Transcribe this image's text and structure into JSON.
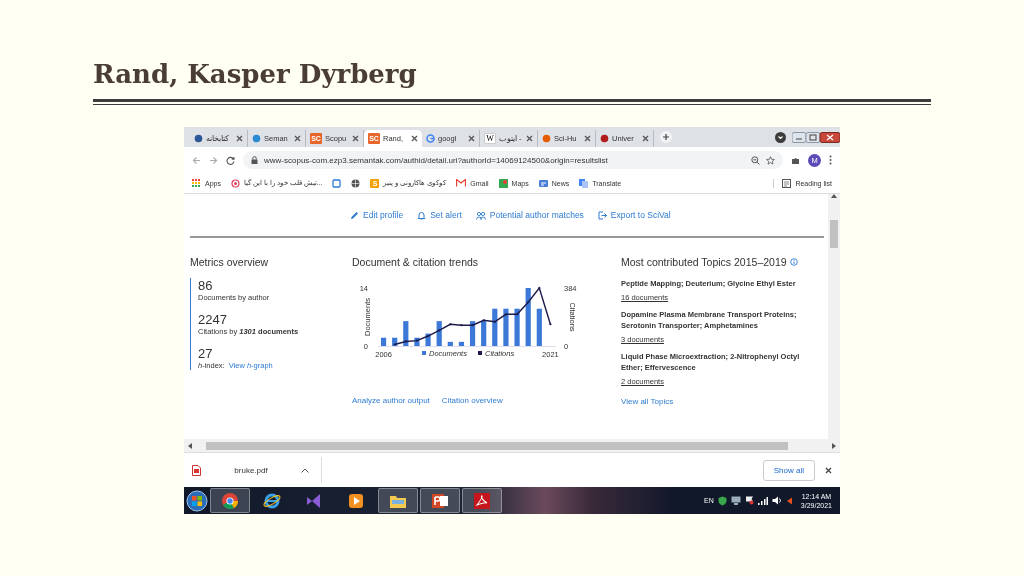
{
  "slide": {
    "title": "Rand, Kasper Dyrberg"
  },
  "browser": {
    "tabs": [
      {
        "title": "كتابخانه",
        "selected": false
      },
      {
        "title": "Seman",
        "selected": false
      },
      {
        "title": "Scopu",
        "icon_text": "SC",
        "selected": false
      },
      {
        "title": "Rand,",
        "icon_text": "SC",
        "selected": true
      },
      {
        "title": "googl",
        "selected": false
      },
      {
        "title": "ايتوب -",
        "icon_text": "W",
        "selected": false
      },
      {
        "title": "Sci-Hu",
        "selected": false
      },
      {
        "title": "Univer",
        "selected": false
      }
    ],
    "address": "www-scopus-com.ezp3.semantak.com/authid/detail.uri?authorId=14069124500&origin=resultslist",
    "profile_initial": "M",
    "bookmarks": [
      {
        "kind": "apps",
        "label": "Apps"
      },
      {
        "kind": "ring",
        "label": "تیش قلب خود را با این گیا..."
      },
      {
        "kind": "square"
      },
      {
        "kind": "globe"
      },
      {
        "kind": "letter",
        "icon_text": "S",
        "label": "کوکوی هاکارونی و پنیر"
      },
      {
        "kind": "mail",
        "label": "Gmail"
      },
      {
        "kind": "map",
        "label": "Maps"
      },
      {
        "kind": "news",
        "label": "News"
      },
      {
        "kind": "translate",
        "label": "Translate"
      }
    ],
    "reading_list": "Reading list"
  },
  "page": {
    "actions": [
      {
        "kind": "pencil",
        "label": "Edit profile"
      },
      {
        "kind": "bell",
        "label": "Set alert"
      },
      {
        "kind": "people",
        "label": "Potential author matches"
      },
      {
        "kind": "export",
        "label": "Export to SciVal"
      }
    ],
    "metrics": {
      "title": "Metrics overview",
      "items": [
        {
          "value": "86",
          "label": "Documents by author"
        },
        {
          "value": "2247",
          "label": "Citations by ***1301* documents**"
        },
        {
          "value": "27",
          "label": "*h*-index:",
          "link": "View *h*-graph"
        }
      ]
    },
    "trends": {
      "title": "Document & citation trends",
      "documents_chart": {
        "chart_data": {
          "type": "bar",
          "ylabel": "Documents",
          "x": [
            2006,
            2007,
            2008,
            2009,
            2010,
            2011,
            2012,
            2013,
            2014,
            2015,
            2016,
            2017,
            2018,
            2019,
            2020,
            2021
          ],
          "series": [
            {
              "name": "Documents",
              "color": "#3b78d8",
              "values": [
                2,
                2,
                6,
                2,
                3,
                6,
                1,
                1,
                6,
                6,
                9,
                9,
                9,
                14,
                9,
                0
              ]
            }
          ],
          "xlim": [
            2005.5,
            2021.5
          ],
          "ylim": [
            0,
            14
          ],
          "yticks": [
            0,
            14
          ],
          "xticks": [
            2006,
            2021
          ]
        }
      },
      "citations_chart": {
        "chart_data": {
          "type": "line",
          "ylabel": "Citations",
          "series": [
            {
              "name": "Citations",
              "color": "#1b1a4a",
              "values": [
                null,
                10,
                30,
                36,
                66,
                104,
                144,
                138,
                138,
                170,
                160,
                210,
                210,
                290,
                384,
                144
              ]
            }
          ],
          "ylim": [
            0,
            384
          ],
          "yticks": [
            0,
            384
          ]
        }
      },
      "links": [
        "Analyze author output",
        "Citation overview"
      ]
    },
    "topics": {
      "title": "Most contributed Topics 2015–2019",
      "items": [
        {
          "name": "Peptide Mapping; Deuterium; Glycine Ethyl Ester",
          "count": "16 documents"
        },
        {
          "name": "Dopamine Plasma Membrane Transport Proteins; Serotonin Transporter; Amphetamines",
          "count": "3 documents"
        },
        {
          "name": "Liquid Phase Microextraction; 2-Nitrophenyl Octyl Ether; Effervescence",
          "count": "2 documents"
        }
      ],
      "link": "View all Topics"
    }
  },
  "downloads": {
    "file": "bruke.pdf",
    "show_all": "Show all"
  },
  "taskbar": {
    "apps": [
      {
        "kind": "chrome",
        "running": true
      },
      {
        "kind": "ie",
        "running": false
      },
      {
        "kind": "vs",
        "running": false
      },
      {
        "kind": "player",
        "running": false
      },
      {
        "kind": "explorer",
        "running": true
      },
      {
        "kind": "powerpoint",
        "running": true
      },
      {
        "kind": "acrobat",
        "running": true
      }
    ],
    "language": "EN",
    "time": "12:14 AM",
    "date": "3/29/2021"
  }
}
